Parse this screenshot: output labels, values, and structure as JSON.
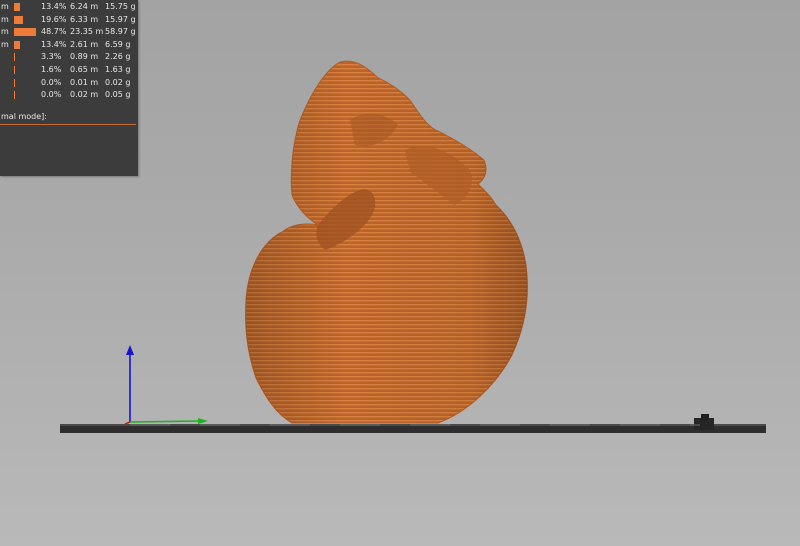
{
  "viewport": {
    "model_color": "#c56a2e",
    "bed_color": "#2e2e2e",
    "axes": {
      "z_color": "#1515d0",
      "x_color": "#d01515",
      "y_color": "#1db21d"
    }
  },
  "legend": {
    "bar_color": "#ef7b39",
    "rows": [
      {
        "unit": "m",
        "percent": "13.4%",
        "length": "6.24 m",
        "weight": "15.75 g",
        "fraction": 0.134
      },
      {
        "unit": "m",
        "percent": "19.6%",
        "length": "6.33 m",
        "weight": "15.97 g",
        "fraction": 0.196
      },
      {
        "unit": "m",
        "percent": "48.7%",
        "length": "23.35 m",
        "weight": "58.97 g",
        "fraction": 0.487
      },
      {
        "unit": "m",
        "percent": "13.4%",
        "length": "2.61 m",
        "weight": "6.59 g",
        "fraction": 0.134
      },
      {
        "unit": "",
        "percent": "3.3%",
        "length": "0.89 m",
        "weight": "2.26 g",
        "fraction": 0.033
      },
      {
        "unit": "",
        "percent": "1.6%",
        "length": "0.65 m",
        "weight": "1.63 g",
        "fraction": 0.016
      },
      {
        "unit": "",
        "percent": "0.0%",
        "length": "0.01 m",
        "weight": "0.02 g",
        "fraction": 0.0
      },
      {
        "unit": "",
        "percent": "0.0%",
        "length": "0.02 m",
        "weight": "0.05 g",
        "fraction": 0.0
      }
    ],
    "mode_note": "mal mode]:"
  }
}
